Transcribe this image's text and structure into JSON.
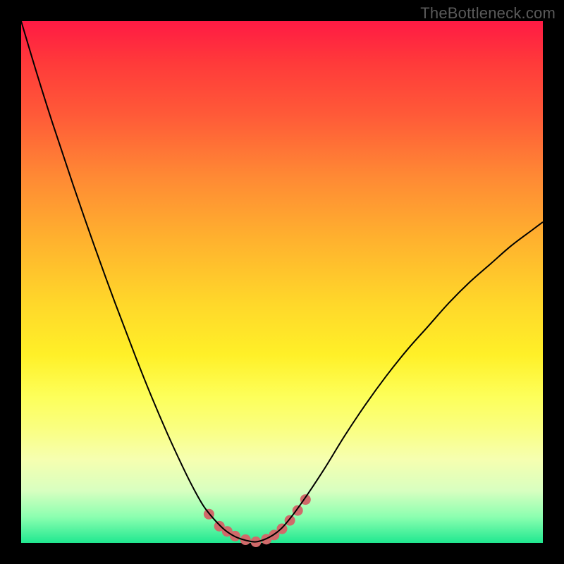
{
  "watermark": "TheBottleneck.com",
  "chart_data": {
    "type": "line",
    "title": "",
    "xlabel": "",
    "ylabel": "",
    "xlim": [
      0,
      100
    ],
    "ylim": [
      0,
      100
    ],
    "grid": false,
    "legend": false,
    "series": [
      {
        "name": "bottleneck-curve",
        "x": [
          0,
          3,
          6,
          10,
          14,
          18,
          22,
          25,
          28,
          31,
          33,
          35,
          37,
          39,
          41,
          43,
          45,
          47,
          49,
          51,
          54,
          58,
          62,
          66,
          70,
          74,
          78,
          82,
          86,
          90,
          94,
          98,
          100
        ],
        "y": [
          100,
          90,
          80.5,
          68.5,
          57,
          46,
          35.5,
          28,
          21,
          14.5,
          10.5,
          7,
          4.5,
          2.5,
          1.2,
          0.5,
          0.2,
          0.8,
          2,
          4,
          8,
          14,
          20.5,
          26.5,
          32,
          37,
          41.5,
          46,
          50,
          53.5,
          57,
          60,
          61.5
        ]
      },
      {
        "name": "highlight-dots",
        "x": [
          36,
          38,
          39.5,
          41,
          43,
          45,
          47,
          48.5,
          50,
          51.5,
          53,
          54.5
        ],
        "y": [
          5.5,
          3.2,
          2.2,
          1.3,
          0.6,
          0.2,
          0.7,
          1.5,
          2.7,
          4.3,
          6.2,
          8.3
        ]
      }
    ],
    "styles": {
      "curve_color": "#000000",
      "curve_width": 2,
      "dot_color": "#d06a6a",
      "dot_radius": 7.5
    }
  }
}
